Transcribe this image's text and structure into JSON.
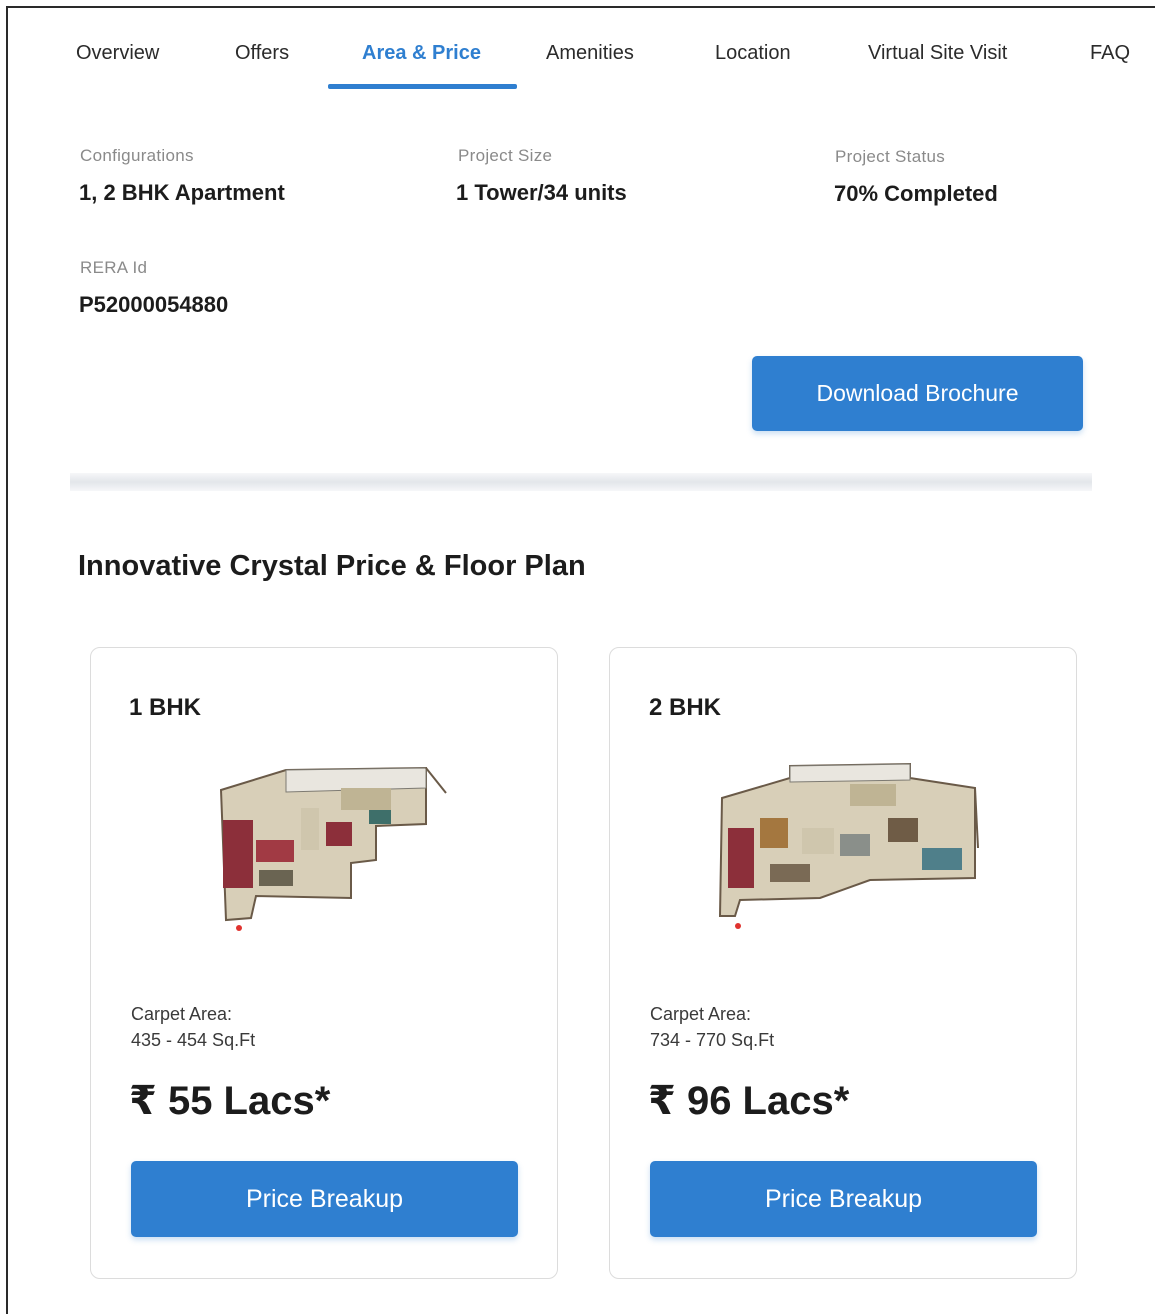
{
  "nav": {
    "tabs": [
      {
        "label": "Overview"
      },
      {
        "label": "Offers"
      },
      {
        "label": "Area & Price",
        "active": true
      },
      {
        "label": "Amenities"
      },
      {
        "label": "Location"
      },
      {
        "label": "Virtual Site Visit"
      },
      {
        "label": "FAQ"
      }
    ],
    "accent_color": "#2f7fd0"
  },
  "project_info": {
    "configurations": {
      "label": "Configurations",
      "value": "1, 2 BHK Apartment"
    },
    "project_size": {
      "label": "Project Size",
      "value": "1 Tower/34 units"
    },
    "project_status": {
      "label": "Project Status",
      "value": "70% Completed"
    },
    "rera": {
      "label": "RERA Id",
      "value": "P52000054880"
    }
  },
  "download_brochure_label": "Download Brochure",
  "section": {
    "title": "Innovative Crystal Price & Floor Plan"
  },
  "units": [
    {
      "title": "1 BHK",
      "carpet_label": "Carpet Area:",
      "carpet_value": "435 - 454 Sq.Ft",
      "price": "₹ 55 Lacs*",
      "button_label": "Price Breakup",
      "image": "floor-plan-1bhk"
    },
    {
      "title": "2 BHK",
      "carpet_label": "Carpet Area:",
      "carpet_value": "734 - 770 Sq.Ft",
      "price": "₹ 96 Lacs*",
      "button_label": "Price Breakup",
      "image": "floor-plan-2bhk"
    }
  ]
}
